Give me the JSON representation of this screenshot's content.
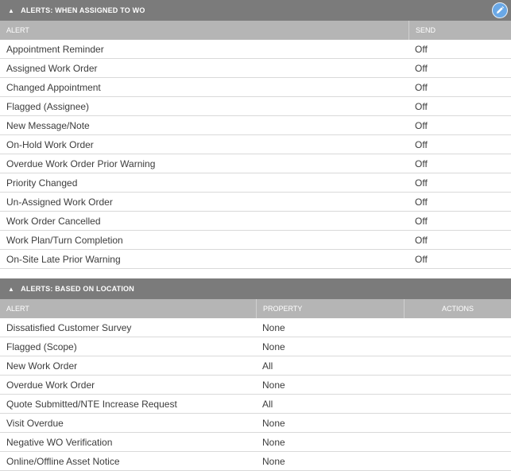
{
  "assigned": {
    "title": "ALERTS: WHEN ASSIGNED TO WO",
    "columns": {
      "alert": "ALERT",
      "send": "SEND"
    },
    "rows": [
      {
        "alert": "Appointment Reminder",
        "send": "Off"
      },
      {
        "alert": "Assigned Work Order",
        "send": "Off"
      },
      {
        "alert": "Changed Appointment",
        "send": "Off"
      },
      {
        "alert": "Flagged (Assignee)",
        "send": "Off"
      },
      {
        "alert": "New Message/Note",
        "send": "Off"
      },
      {
        "alert": "On-Hold Work Order",
        "send": "Off"
      },
      {
        "alert": "Overdue Work Order Prior Warning",
        "send": "Off"
      },
      {
        "alert": "Priority Changed",
        "send": "Off"
      },
      {
        "alert": "Un-Assigned Work Order",
        "send": "Off"
      },
      {
        "alert": "Work Order Cancelled",
        "send": "Off"
      },
      {
        "alert": "Work Plan/Turn Completion",
        "send": "Off"
      },
      {
        "alert": "On-Site Late Prior Warning",
        "send": "Off"
      }
    ]
  },
  "location": {
    "title": "ALERTS: BASED ON LOCATION",
    "columns": {
      "alert": "ALERT",
      "property": "PROPERTY",
      "actions": "ACTIONS"
    },
    "rows": [
      {
        "alert": "Dissatisfied Customer Survey",
        "property": "None"
      },
      {
        "alert": "Flagged (Scope)",
        "property": "None"
      },
      {
        "alert": "New Work Order",
        "property": "All"
      },
      {
        "alert": "Overdue Work Order",
        "property": "None"
      },
      {
        "alert": "Quote Submitted/NTE Increase Request",
        "property": "All"
      },
      {
        "alert": "Visit Overdue",
        "property": "None"
      },
      {
        "alert": "Negative WO Verification",
        "property": "None"
      },
      {
        "alert": "Online/Offline Asset Notice",
        "property": "None"
      }
    ]
  },
  "icons": {
    "collapse": "triangle-up-icon",
    "edit": "pencil-icon"
  },
  "colors": {
    "header": "#7b7b7b",
    "column_header": "#b5b5b5",
    "edit_button": "#6aa8e6"
  }
}
